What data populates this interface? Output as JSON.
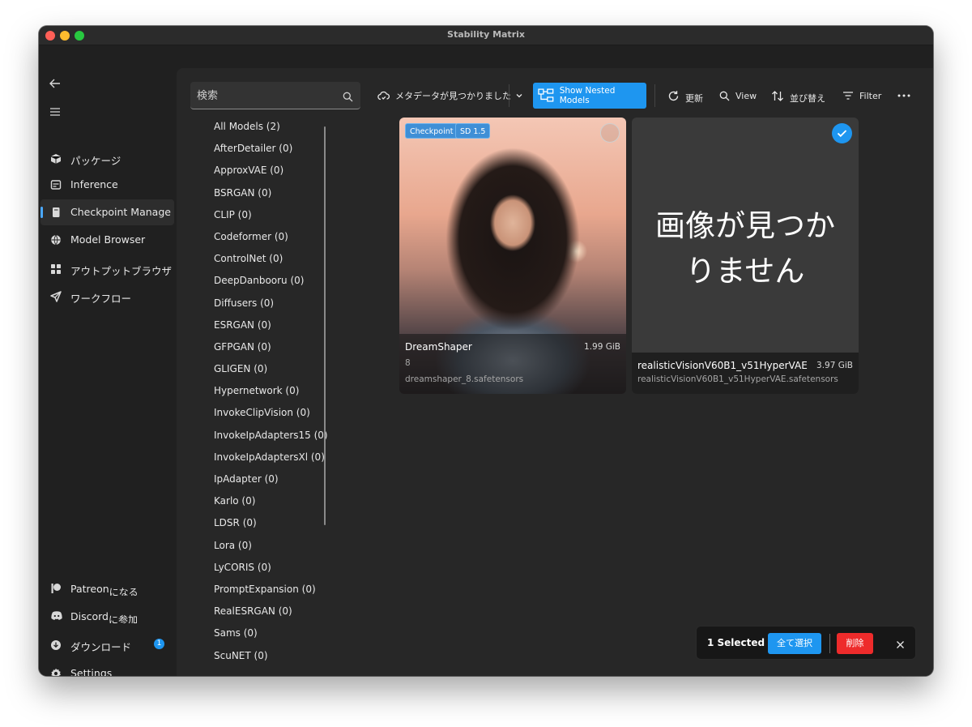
{
  "window": {
    "title": "Stability Matrix"
  },
  "sidebar": {
    "items": [
      {
        "label": "パッケージ",
        "icon": "package-icon"
      },
      {
        "label": "Inference",
        "icon": "inference-icon"
      },
      {
        "label": "Checkpoint Manager",
        "icon": "checkpoint-icon",
        "active": true
      },
      {
        "label": "Model Browser",
        "icon": "model-browser-icon"
      },
      {
        "label": "アウトプットブラウザ",
        "icon": "grid-icon"
      },
      {
        "label": "ワークフロー",
        "icon": "send-icon"
      }
    ],
    "footer": {
      "patreon": {
        "label": "Patreon",
        "sub": "になる"
      },
      "discord": {
        "label": "Discord",
        "sub": "に参加"
      },
      "downloads": {
        "label": "ダウンロード",
        "badge": "1"
      },
      "settings": {
        "label": "Settings"
      }
    }
  },
  "search": {
    "placeholder": "検索"
  },
  "folders": [
    "All Models  (2)",
    "AfterDetailer  (0)",
    "ApproxVAE  (0)",
    "BSRGAN  (0)",
    "CLIP  (0)",
    "Codeformer  (0)",
    "ControlNet  (0)",
    "DeepDanbooru  (0)",
    "Diffusers  (0)",
    "ESRGAN  (0)",
    "GFPGAN  (0)",
    "GLIGEN  (0)",
    "Hypernetwork  (0)",
    "InvokeClipVision  (0)",
    "InvokeIpAdapters15  (0)",
    "InvokeIpAdaptersXl  (0)",
    "IpAdapter  (0)",
    "Karlo  (0)",
    "LDSR  (0)",
    "Lora  (0)",
    "LyCORIS  (0)",
    "PromptExpansion  (0)",
    "RealESRGAN  (0)",
    "Sams  (0)",
    "ScuNET  (0)"
  ],
  "toolbar": {
    "metadata_label": "メタデータが見つかりました",
    "nested_label": "Show Nested Models",
    "refresh_label": "更新",
    "view_label": "View",
    "sort_label": "並び替え",
    "filter_label": "Filter",
    "accent_color": "#1e96f0"
  },
  "cards": [
    {
      "tags": [
        "Checkpoint",
        "SD 1.5"
      ],
      "name": "DreamShaper",
      "version": "8",
      "size": "1.99 GiB",
      "file": "dreamshaper_8.safetensors",
      "selected": false
    },
    {
      "placeholder_text": "画像が見つかりません",
      "name": "realisticVisionV60B1_v51HyperVAE",
      "size": "3.97 GiB",
      "file": "realisticVisionV60B1_v51HyperVAE.safetensors",
      "selected": true
    }
  ],
  "selection_bar": {
    "count": "1 Selected",
    "select_all": "全て選択",
    "delete": "削除",
    "delete_color": "#ee2b2b"
  }
}
